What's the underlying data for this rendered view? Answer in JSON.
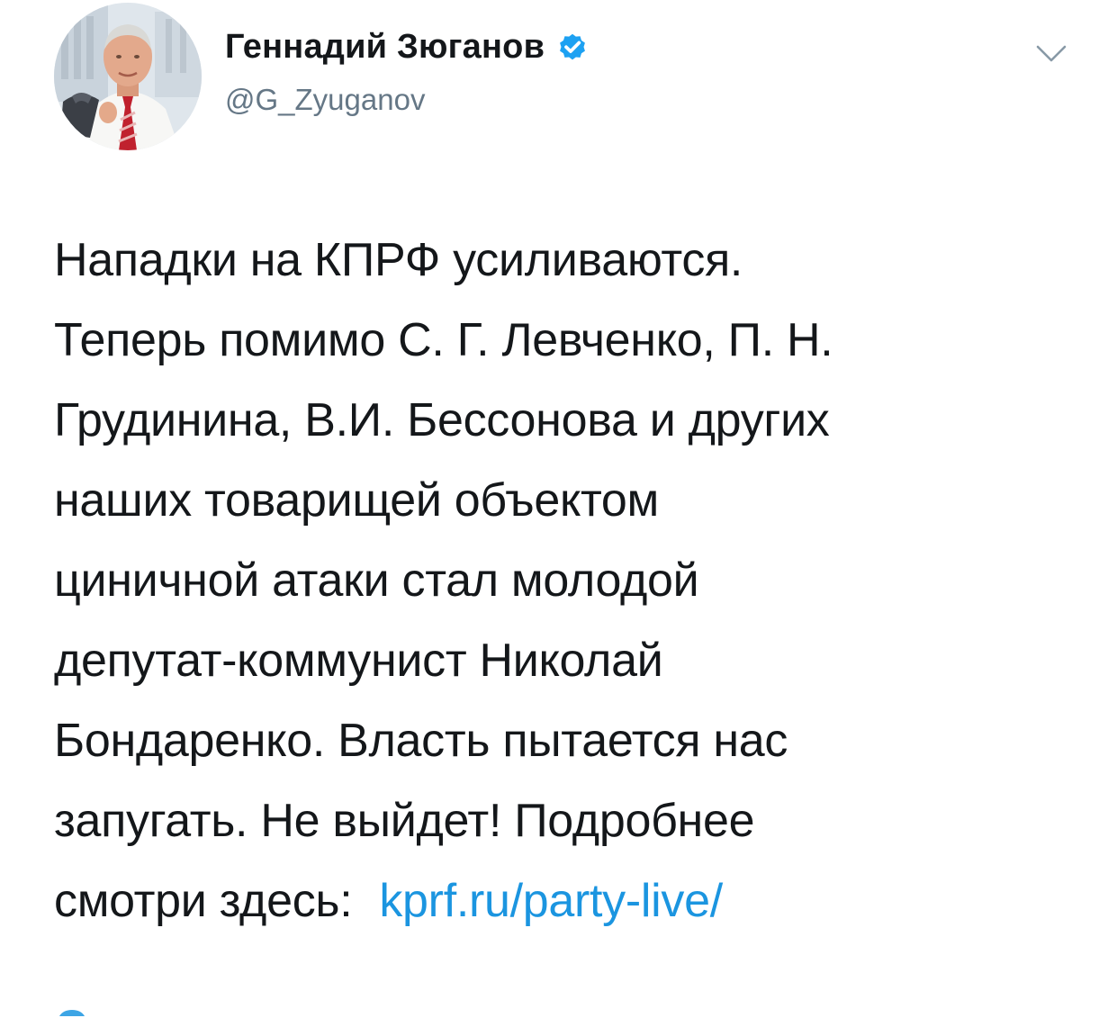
{
  "author": {
    "display_name": "Геннадий Зюганов",
    "handle": "@G_Zyuganov",
    "verified": true
  },
  "tweet": {
    "lines": [
      "Нападки на КПРФ усиливаются.",
      "Теперь помимо С. Г. Левченко, П. Н.",
      "Грудинина, В.И. Бессонова и других",
      "наших товарищей объектом",
      "циничной атаки стал молодой",
      "депутат-коммунист Николай",
      "Бондаренко. Власть пытается нас",
      "запугать. Не выйдет! Подробнее"
    ],
    "last_line_text": "смотри здесь:",
    "link_text": "kprf.ru/party-live/"
  },
  "icons": {
    "verified": "verified-badge-icon",
    "menu": "chevron-down-icon"
  },
  "colors": {
    "text": "#14171a",
    "secondary": "#657786",
    "link": "#1b95e0",
    "verified": "#1da1f2"
  }
}
